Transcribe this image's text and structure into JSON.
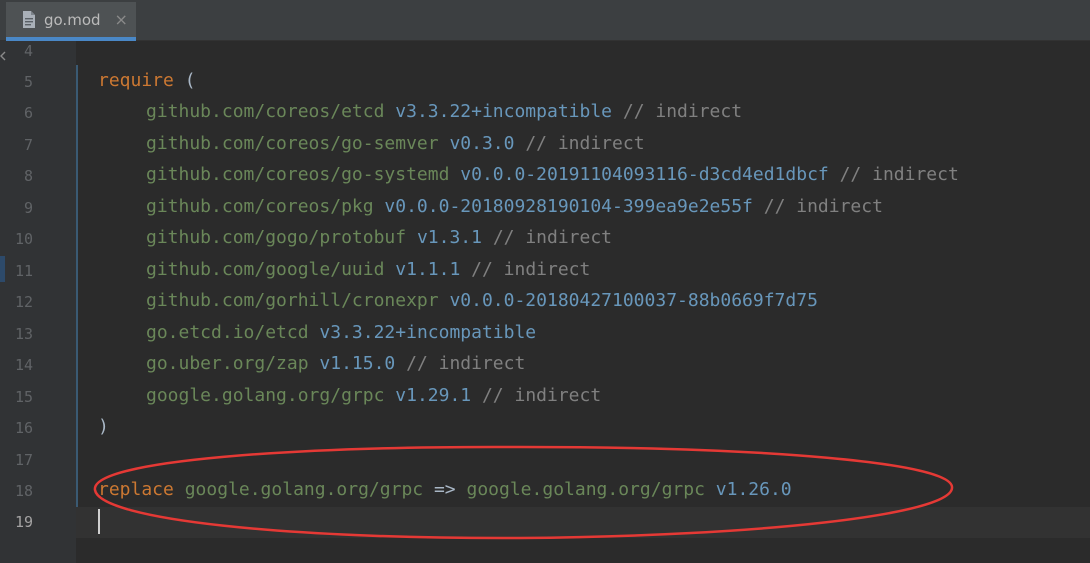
{
  "tab": {
    "label": "go.mod",
    "close": "×",
    "icon": "file-icon"
  },
  "colors": {
    "keyword": "#cc7832",
    "module": "#6a8759",
    "version": "#6897bb",
    "comment": "#808080",
    "annotation": "#e53935"
  },
  "editor": {
    "line_numbers": [
      "4",
      "5",
      "6",
      "7",
      "8",
      "9",
      "10",
      "11",
      "12",
      "13",
      "14",
      "15",
      "16",
      "17",
      "18",
      "19"
    ],
    "current_line": "19",
    "require_kw": "require",
    "open_paren": "(",
    "close_paren": ")",
    "requires": [
      {
        "module": "github.com/coreos/etcd",
        "version": "v3.3.22+incompatible",
        "comment": "// indirect"
      },
      {
        "module": "github.com/coreos/go-semver",
        "version": "v0.3.0",
        "comment": "// indirect"
      },
      {
        "module": "github.com/coreos/go-systemd",
        "version": "v0.0.0-20191104093116-d3cd4ed1dbcf",
        "comment": "// indirect"
      },
      {
        "module": "github.com/coreos/pkg",
        "version": "v0.0.0-20180928190104-399ea9e2e55f",
        "comment": "// indirect"
      },
      {
        "module": "github.com/gogo/protobuf",
        "version": "v1.3.1",
        "comment": "// indirect"
      },
      {
        "module": "github.com/google/uuid",
        "version": "v1.1.1",
        "comment": "// indirect"
      },
      {
        "module": "github.com/gorhill/cronexpr",
        "version": "v0.0.0-20180427100037-88b0669f7d75",
        "comment": ""
      },
      {
        "module": "go.etcd.io/etcd",
        "version": "v3.3.22+incompatible",
        "comment": ""
      },
      {
        "module": "go.uber.org/zap",
        "version": "v1.15.0",
        "comment": "// indirect"
      },
      {
        "module": "google.golang.org/grpc",
        "version": "v1.29.1",
        "comment": "// indirect"
      }
    ],
    "replace": {
      "keyword": "replace",
      "from": "google.golang.org/grpc",
      "arrow": "=>",
      "to": "google.golang.org/grpc",
      "version": "v1.26.0"
    }
  }
}
